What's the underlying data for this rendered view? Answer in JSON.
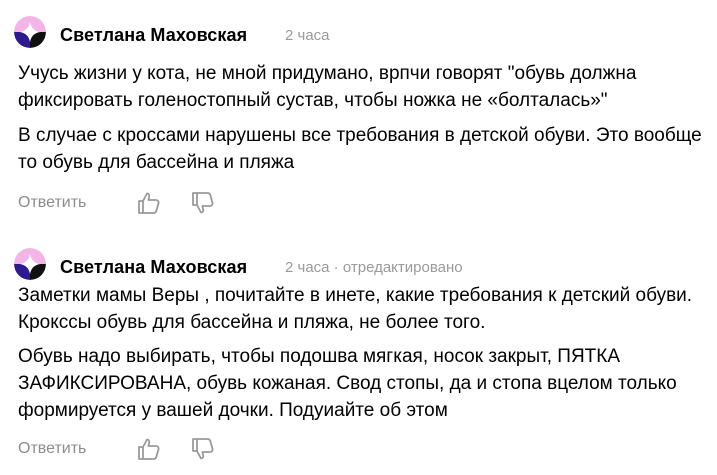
{
  "comments": [
    {
      "author": "Светлана Маховская",
      "time": "2 часа",
      "paragraphs": [
        "Учусь жизни у кота, не мной придумано, врпчи говорят \"обувь должна фиксировать голеностопный сустав, чтобы ножка не «болталась»\"",
        "В случае с кроссами нарушены все требования в детской обуви. Это вообще то обувь для бассейна и пляжа"
      ],
      "reply_label": "Ответить",
      "like_icon": "thumbs-up-icon",
      "dislike_icon": "thumbs-down-icon"
    },
    {
      "author": "Светлана Маховская",
      "time": "2 часа · отредактировано",
      "paragraphs": [
        "Заметки мамы Веры , почитайте в инете, какие требования к детский обуви. Кроксcы обувь для бассейна и пляжа, не более того.",
        "Обувь надо выбирать, чтобы подошва мягкая, носок закрыт, ПЯТКА ЗАФИКСИРОВАНА, обувь кожаная. Свод стопы, да и стопа вцелом только формируется у вашей дочки. Подуиайте об этом"
      ],
      "reply_label": "Ответить",
      "like_icon": "thumbs-up-icon",
      "dislike_icon": "thumbs-down-icon"
    }
  ],
  "colors": {
    "avatar_purple": "#2e1a8c",
    "avatar_pink": "#f3b4e6",
    "avatar_white": "#ffffff",
    "avatar_dark": "#111111",
    "meta_gray": "#9a9a9a",
    "icon_gray": "#9a9a9a"
  }
}
